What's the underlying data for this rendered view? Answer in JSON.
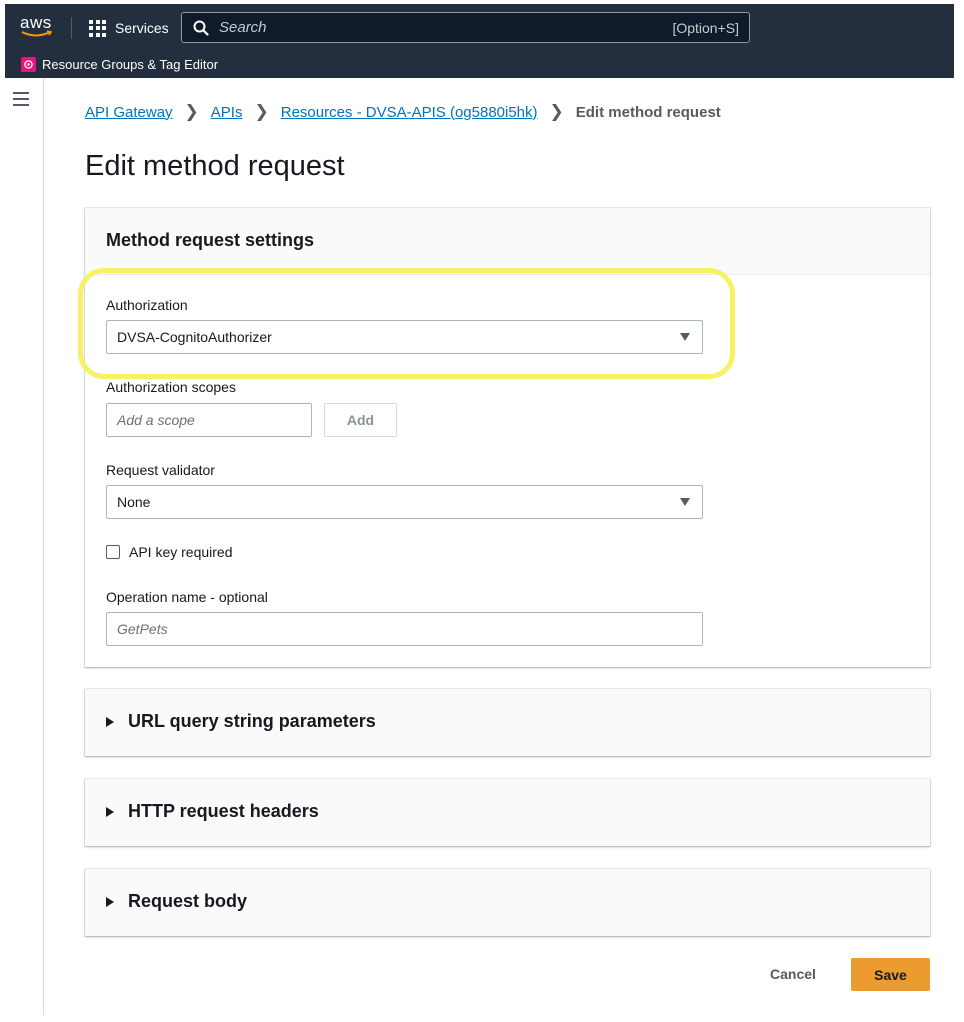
{
  "topnav": {
    "logo_text": "aws",
    "services_label": "Services",
    "search_placeholder": "Search",
    "search_shortcut": "[Option+S]",
    "resource_groups_label": "Resource Groups & Tag Editor",
    "background": "#232f3e"
  },
  "breadcrumb": {
    "items": [
      "API Gateway",
      "APIs",
      "Resources - DVSA-APIS (og5880i5hk)"
    ],
    "current": "Edit method request"
  },
  "page_title": "Edit method request",
  "settings": {
    "header": "Method request settings",
    "authorization": {
      "label": "Authorization",
      "value": "DVSA-CognitoAuthorizer"
    },
    "scopes": {
      "label": "Authorization scopes",
      "placeholder": "Add a scope",
      "add_label": "Add"
    },
    "validator": {
      "label": "Request validator",
      "value": "None"
    },
    "api_key": {
      "label": "API key required",
      "checked": false
    },
    "operation": {
      "label": "Operation name - optional",
      "placeholder": "GetPets"
    }
  },
  "sections": [
    {
      "title": "URL query string parameters"
    },
    {
      "title": "HTTP request headers"
    },
    {
      "title": "Request body"
    }
  ],
  "actions": {
    "cancel_label": "Cancel",
    "save_label": "Save",
    "save_color": "#ec9b2f"
  },
  "highlight_color": "#f7f265",
  "link_color": "#0073bb"
}
